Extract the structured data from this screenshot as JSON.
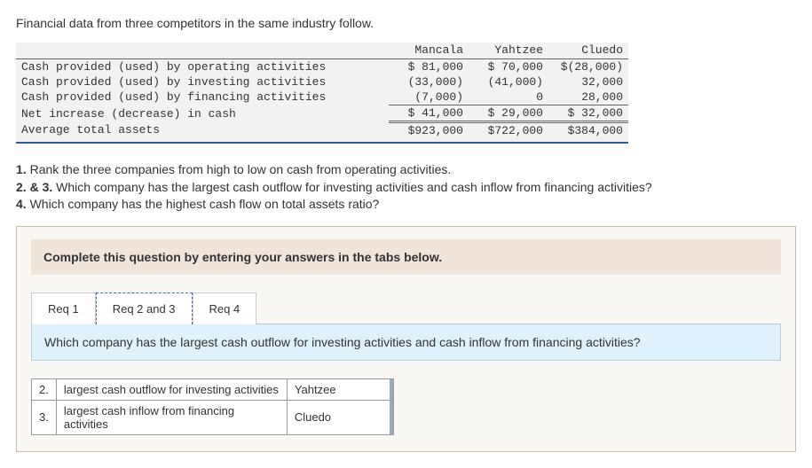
{
  "intro": "Financial data from three competitors in the same industry follow.",
  "table": {
    "headers": [
      "",
      "Mancala",
      "Yahtzee",
      "Cluedo"
    ],
    "rows": [
      {
        "label": "Cash provided (used) by operating activities",
        "c1": "$ 81,000",
        "c2": "$ 70,000",
        "c3": "$(28,000)"
      },
      {
        "label": "Cash provided (used) by investing activities",
        "c1": "(33,000)",
        "c2": "(41,000)",
        "c3": "32,000"
      },
      {
        "label": "Cash provided (used) by financing activities",
        "c1": "(7,000)",
        "c2": "0",
        "c3": "28,000"
      },
      {
        "label": "Net increase (decrease) in cash",
        "c1": "$ 41,000",
        "c2": "$ 29,000",
        "c3": "$ 32,000"
      },
      {
        "label": "Average total assets",
        "c1": "$923,000",
        "c2": "$722,000",
        "c3": "$384,000"
      }
    ]
  },
  "questions": {
    "q1_label": "1.",
    "q1": "Rank the three companies from high to low on cash from operating activities.",
    "q23_label": "2. & 3.",
    "q23": "Which company has the largest cash outflow for investing activities and cash inflow from financing activities?",
    "q4_label": "4.",
    "q4": "Which company has the highest cash flow on total assets ratio?"
  },
  "instruct": "Complete this question by entering your answers in the tabs below.",
  "tabs": {
    "t1": "Req 1",
    "t2": "Req 2 and 3",
    "t3": "Req 4"
  },
  "active_tab_prompt": "Which company has the largest cash outflow for investing activities and cash inflow from financing activities?",
  "answers": {
    "r2": {
      "num": "2.",
      "label": "largest cash outflow for investing activities",
      "value": "Yahtzee"
    },
    "r3": {
      "num": "3.",
      "label": "largest cash inflow from financing activities",
      "value": "Cluedo"
    }
  }
}
